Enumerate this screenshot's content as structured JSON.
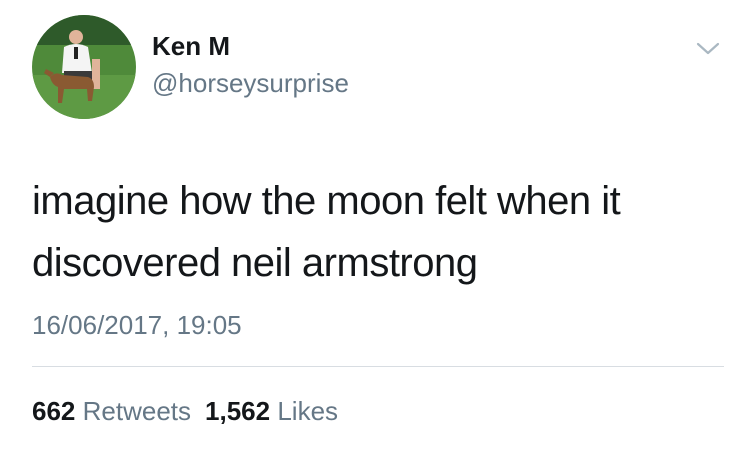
{
  "tweet": {
    "author": {
      "display_name": "Ken M",
      "handle": "@horseysurprise",
      "avatar_icon": "profile-photo-man-with-foal"
    },
    "text": "imagine how the moon felt when it discovered neil armstrong",
    "timestamp": "16/06/2017, 19:05",
    "stats": {
      "retweets_count": "662",
      "retweets_label": "Retweets",
      "likes_count": "1,562",
      "likes_label": "Likes"
    },
    "menu_icon": "chevron-down-icon"
  },
  "colors": {
    "primary_text": "#14171a",
    "secondary_text": "#657786",
    "divider": "#d8dde2",
    "background": "#ffffff"
  }
}
